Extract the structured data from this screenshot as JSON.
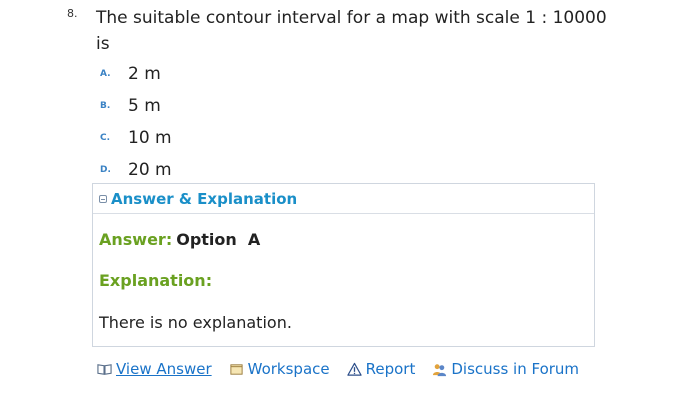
{
  "question": {
    "number": "8.",
    "text": "The suitable contour interval for a map with scale 1 : 10000 is"
  },
  "options": [
    {
      "letter": "A.",
      "text": "2 m"
    },
    {
      "letter": "B.",
      "text": "5 m"
    },
    {
      "letter": "C.",
      "text": "10 m"
    },
    {
      "letter": "D.",
      "text": "20 m"
    }
  ],
  "panel": {
    "title": "Answer & Explanation",
    "answer_label": "Answer:",
    "answer_value": "Option  A",
    "explanation_label": "Explanation:",
    "explanation_text": "There is no explanation."
  },
  "links": {
    "view_answer": "View Answer",
    "workspace": "Workspace",
    "report": "Report",
    "discuss": "Discuss in Forum"
  },
  "colors": {
    "accent_blue": "#1a8fc8",
    "link_blue": "#1a73c8",
    "green": "#6aa121"
  },
  "icons": {
    "view_answer": "book-icon",
    "workspace": "notepad-icon",
    "report": "warning-icon",
    "discuss": "users-icon"
  }
}
